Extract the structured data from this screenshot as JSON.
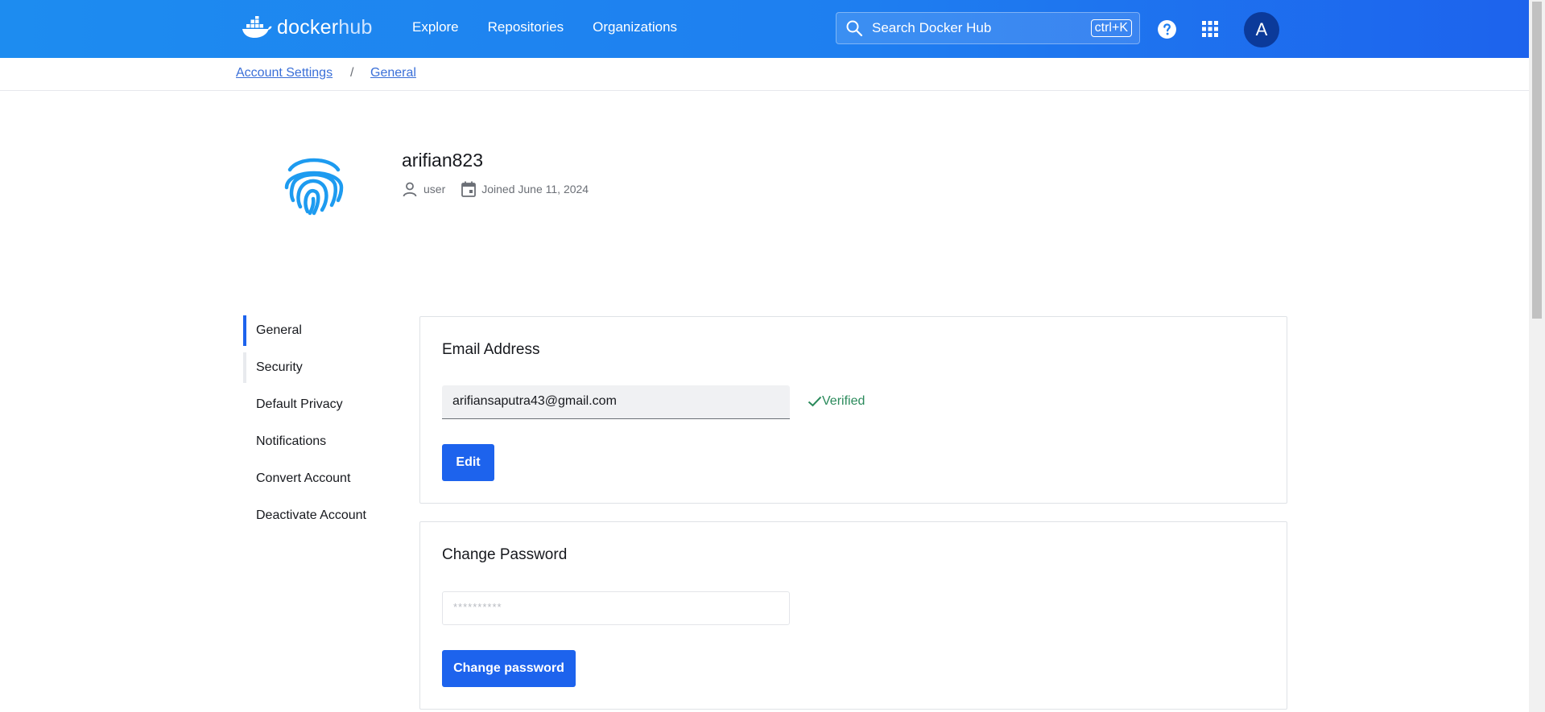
{
  "header": {
    "logo": {
      "docker": "docker",
      "hub": "hub"
    },
    "nav": [
      "Explore",
      "Repositories",
      "Organizations"
    ],
    "search": {
      "placeholder": "Search Docker Hub",
      "shortcut": "ctrl+K"
    },
    "avatar_initial": "A",
    "brand_color": "#1d63ed"
  },
  "breadcrumb": {
    "items": [
      "Account Settings",
      "General"
    ],
    "separator": "/"
  },
  "profile": {
    "username": "arifian823",
    "role": "user",
    "joined": "Joined June 11, 2024",
    "avatar_icon": "fingerprint-icon"
  },
  "sidebar": {
    "items": [
      {
        "label": "General",
        "active": true
      },
      {
        "label": "Security",
        "active": false
      },
      {
        "label": "Default Privacy",
        "active": false
      },
      {
        "label": "Notifications",
        "active": false
      },
      {
        "label": "Convert Account",
        "active": false
      },
      {
        "label": "Deactivate Account",
        "active": false
      }
    ]
  },
  "email_card": {
    "title": "Email Address",
    "email": "arifiansaputra43@gmail.com",
    "status": "Verified",
    "edit_label": "Edit"
  },
  "password_card": {
    "title": "Change Password",
    "placeholder": "**********",
    "button_label": "Change password"
  }
}
